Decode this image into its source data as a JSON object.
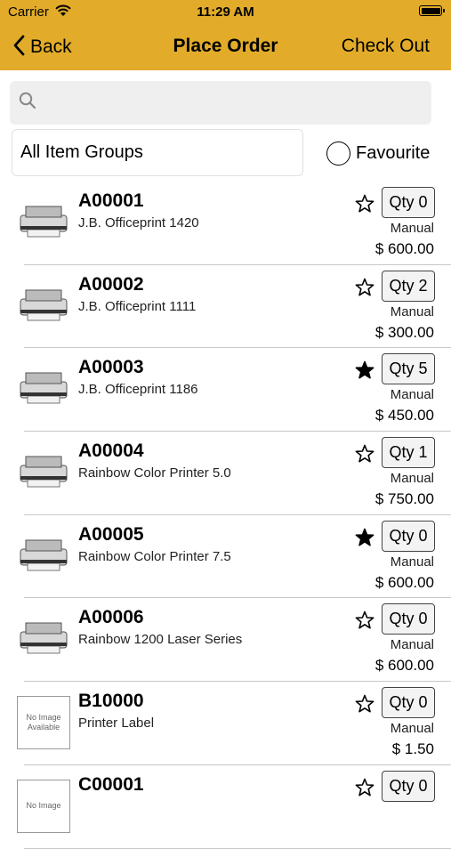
{
  "status_bar": {
    "carrier": "Carrier",
    "time": "11:29 AM"
  },
  "nav": {
    "back_label": "Back",
    "title": "Place Order",
    "checkout_label": "Check Out"
  },
  "search": {
    "placeholder": "",
    "value": ""
  },
  "filter": {
    "group_label": "All Item Groups",
    "favourite_label": "Favourite",
    "favourite_selected": false
  },
  "items": [
    {
      "code": "A00001",
      "name": "J.B. Officeprint 1420",
      "qty": "Qty 0",
      "mode": "Manual",
      "price": "$ 600.00",
      "favourite": false,
      "image": "printer-icon"
    },
    {
      "code": "A00002",
      "name": "J.B. Officeprint 1111",
      "qty": "Qty 2",
      "mode": "Manual",
      "price": "$ 300.00",
      "favourite": false,
      "image": "printer-icon"
    },
    {
      "code": "A00003",
      "name": "J.B. Officeprint 1186",
      "qty": "Qty 5",
      "mode": "Manual",
      "price": "$ 450.00",
      "favourite": true,
      "image": "printer-icon"
    },
    {
      "code": "A00004",
      "name": "Rainbow Color Printer 5.0",
      "qty": "Qty 1",
      "mode": "Manual",
      "price": "$ 750.00",
      "favourite": false,
      "image": "printer-icon"
    },
    {
      "code": "A00005",
      "name": "Rainbow Color Printer 7.5",
      "qty": "Qty 0",
      "mode": "Manual",
      "price": "$ 600.00",
      "favourite": true,
      "image": "printer-icon"
    },
    {
      "code": "A00006",
      "name": "Rainbow 1200 Laser Series",
      "qty": "Qty 0",
      "mode": "Manual",
      "price": "$ 600.00",
      "favourite": false,
      "image": "printer-icon"
    },
    {
      "code": "B10000",
      "name": "Printer Label",
      "qty": "Qty 0",
      "mode": "Manual",
      "price": "$ 1.50",
      "favourite": false,
      "image": "no-image",
      "no_image_text": "No Image Available"
    },
    {
      "code": "C00001",
      "name": "",
      "qty": "Qty 0",
      "mode": "",
      "price": "",
      "favourite": false,
      "image": "no-image",
      "no_image_text": "No Image"
    }
  ],
  "colors": {
    "header": "#e2ac2a",
    "search_bg": "#efefef",
    "separator": "#c8c8c8"
  }
}
